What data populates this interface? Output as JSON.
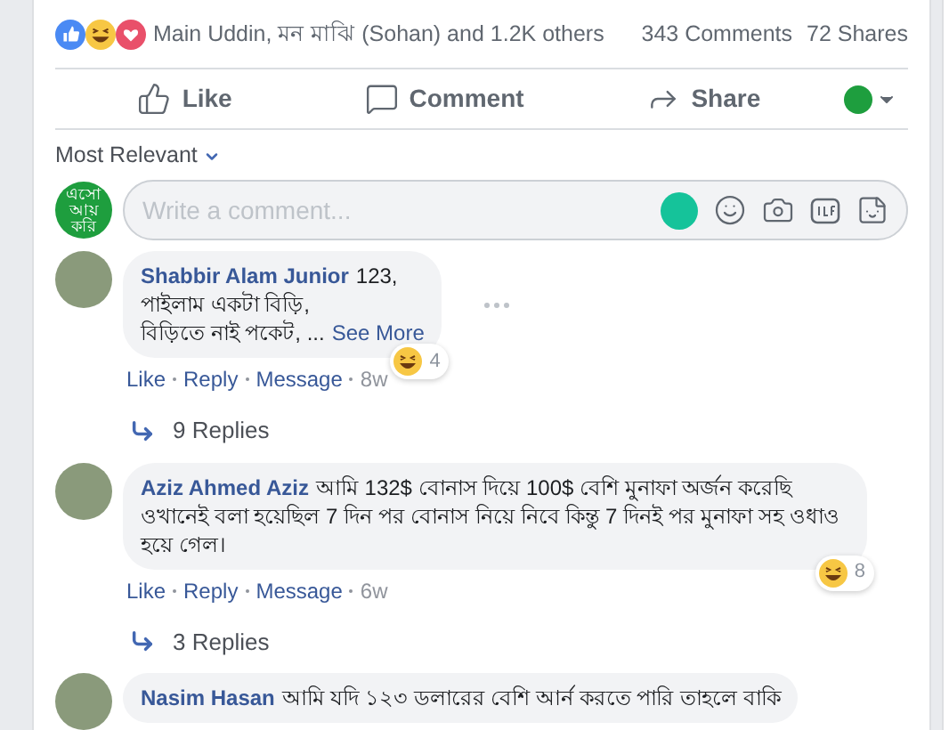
{
  "reactions_summary": {
    "text": "Main Uddin, মন মাঝি (Sohan) and 1.2K others",
    "comments": "343 Comments",
    "shares": "72 Shares"
  },
  "actions": [
    {
      "kind": "like",
      "label": "Like"
    },
    {
      "kind": "comment",
      "label": "Comment"
    },
    {
      "kind": "share",
      "label": "Share"
    }
  ],
  "sort": {
    "label": "Most Relevant"
  },
  "composer": {
    "avatar_text": "এসো আয় করি",
    "placeholder": "Write a comment..."
  },
  "comments": [
    {
      "author": "Shabbir Alam Junior",
      "lines": [
        "123,",
        "পাইলাম একটা বিড়ি,",
        "বিড়িতে নাই পকেট, ..."
      ],
      "see_more": "See More",
      "reaction_count": "4",
      "links": [
        "Like",
        "Reply",
        "Message"
      ],
      "time": "8w",
      "replies": "9 Replies",
      "hovered": true
    },
    {
      "author": "Aziz Ahmed Aziz",
      "lines": [
        "আমি 132$ বোনাস দিয়ে 100$ বেশি মুনাফা অর্জন করেছি ওখানেই বলা হয়েছিল 7 দিন পর বোনাস নিয়ে নিবে কিন্তু 7 দিনই পর মুনাফা সহ ওধাও হয়ে গেল।"
      ],
      "reaction_count": "8",
      "links": [
        "Like",
        "Reply",
        "Message"
      ],
      "time": "6w",
      "replies": "3 Replies",
      "hovered": false
    },
    {
      "author": "Nasim Hasan",
      "lines": [
        "আমি যদি ১২৩ ডলারের বেশি আর্ন করতে পারি তাহলে বাকি"
      ],
      "hovered": false
    }
  ]
}
